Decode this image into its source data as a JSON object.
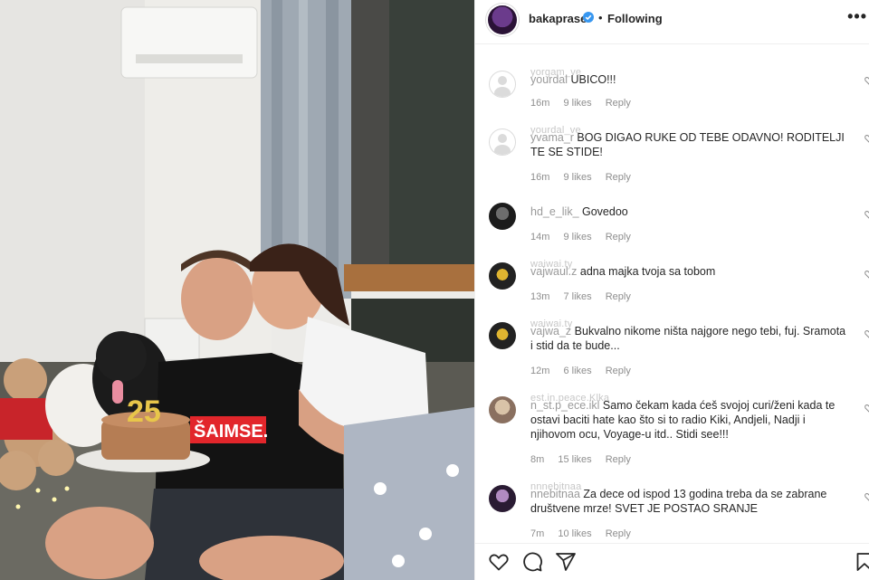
{
  "post": {
    "image_alt": "Couple with birthday cake numbered 25 and a dog"
  },
  "header": {
    "username": "bakaprase",
    "verified_icon": "verified-badge-icon",
    "separator": "•",
    "follow_state": "Following",
    "more_icon": "more-options-icon",
    "more_glyph": "•••"
  },
  "comments": [
    {
      "user_overlay": "yorgam_ve",
      "user_prefix": "yourdal",
      "text": "UBICO!!!",
      "time": "16m",
      "likes": "9 likes",
      "reply": "Reply",
      "avatar": "default"
    },
    {
      "user_overlay": "yourdal_ve",
      "user_prefix": "yvama_r",
      "text": "BOG DIGAO RUKE OD TEBE ODAVNO! RODITELJI TE SE STIDE!",
      "time": "16m",
      "likes": "9 likes",
      "reply": "Reply",
      "avatar": "default"
    },
    {
      "user_overlay": "",
      "user_prefix": "hd_e_lik_",
      "text": "Govedoo",
      "time": "14m",
      "likes": "9 likes",
      "reply": "Reply",
      "avatar": "photo-dark"
    },
    {
      "user_overlay": "waiwai.ty",
      "user_prefix": "vajwaul.z",
      "text": "adna majka tvoja sa tobom",
      "time": "13m",
      "likes": "7 likes",
      "reply": "Reply",
      "avatar": "photo-yellow"
    },
    {
      "user_overlay": "waiwai.ty",
      "user_prefix": "vajwa_z",
      "text": "Bukvalno nikome ništa najgore nego tebi, fuj. Sramota i stid da te bude...",
      "time": "12m",
      "likes": "6 likes",
      "reply": "Reply",
      "avatar": "photo-yellow"
    },
    {
      "user_overlay": "est.in.peace.Klka",
      "user_prefix": "n_st.p_ece.ikl",
      "text": "Samo čekam kada ćeš svojoj curi/ženi kada te ostavi baciti hate kao što si to radio Kiki, Andjeli, Nadji i njihovom ocu, Voyage-u itd.. Stidi see!!!",
      "time": "8m",
      "likes": "15 likes",
      "reply": "Reply",
      "avatar": "photo-light"
    },
    {
      "user_overlay": "nnnebitnaa",
      "user_prefix": "nnebitnaa",
      "text": "Za dece od ispod 13 godina treba da se zabrane društvene mrze! SVET JE POSTAO SRANJE",
      "time": "7m",
      "likes": "10 likes",
      "reply": "Reply",
      "avatar": "photo-purple"
    }
  ],
  "actions": {
    "like_icon": "heart-icon",
    "comment_icon": "comment-icon",
    "share_icon": "share-icon",
    "save_icon": "bookmark-icon"
  },
  "colors": {
    "text": "#262626",
    "meta": "#8e8e8e",
    "verified": "#3897f0",
    "divider": "#efefef"
  }
}
